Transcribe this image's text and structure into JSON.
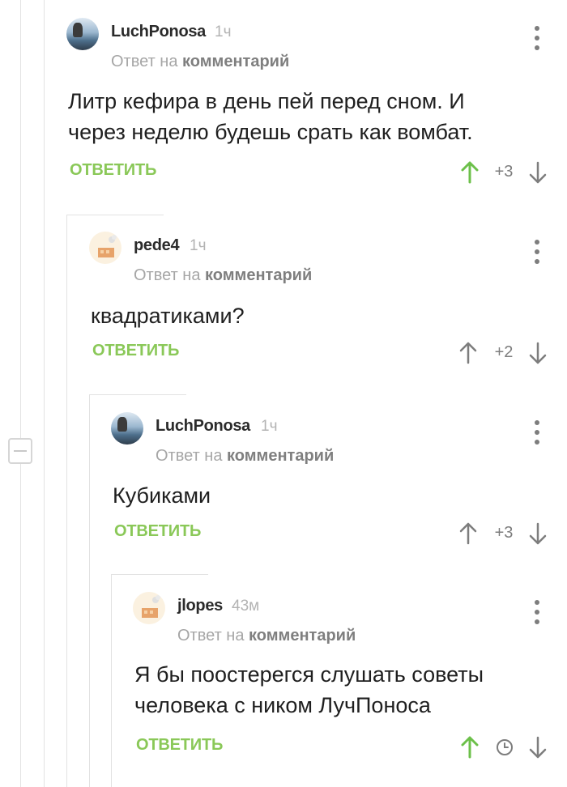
{
  "comments": [
    {
      "author": "LuchPonosa",
      "time": "1ч",
      "reply_prefix": "Ответ на",
      "reply_target": "комментарий",
      "text_lines": [
        "Литр кефира в день пей перед сном. И",
        "через неделю будешь срать как вомбат."
      ],
      "reply_label": "ОТВЕТИТЬ",
      "rating": "+3",
      "upvoted": true,
      "avatar": "user-photo"
    },
    {
      "author": "pede4",
      "time": "1ч",
      "reply_prefix": "Ответ на",
      "reply_target": "комментарий",
      "text_lines": [
        "квадратиками?"
      ],
      "reply_label": "ОТВЕТИТЬ",
      "rating": "+2",
      "upvoted": false,
      "avatar": "default-avatar"
    },
    {
      "author": "LuchPonosa",
      "time": "1ч",
      "reply_prefix": "Ответ на",
      "reply_target": "комментарий",
      "text_lines": [
        "Кубиками"
      ],
      "reply_label": "ОТВЕТИТЬ",
      "rating": "+3",
      "upvoted": false,
      "avatar": "user-photo"
    },
    {
      "author": "jlopes",
      "time": "43м",
      "reply_prefix": "Ответ на",
      "reply_target": "комментарий",
      "text_lines": [
        "Я бы поостерегся слушать советы",
        "человека с ником ЛучПоноса"
      ],
      "reply_label": "ОТВЕТИТЬ",
      "rating": "",
      "rating_icon": "clock-icon",
      "upvoted": true,
      "avatar": "default-avatar"
    }
  ],
  "colors": {
    "accent_green": "#8ac858",
    "upvote_active": "#6cc04a",
    "muted": "#a6a6a6",
    "thread_line": "#e2e2e2"
  }
}
